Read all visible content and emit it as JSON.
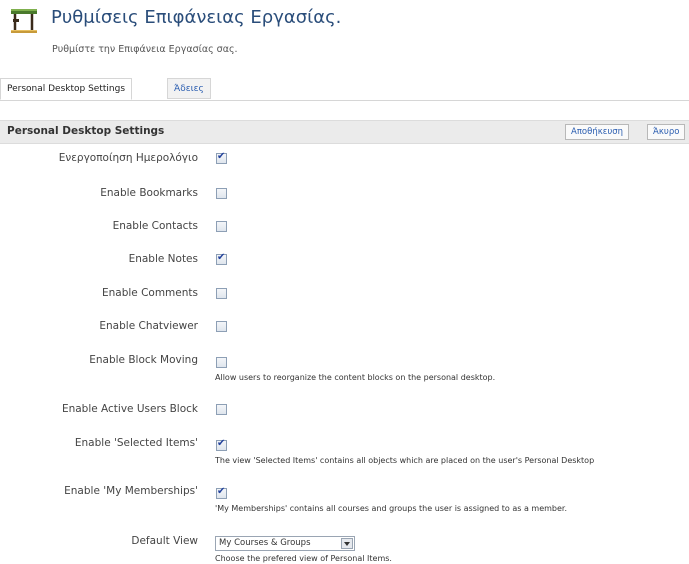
{
  "header": {
    "title": "Ρυθμίσεις Επιφάνειας Εργασίας.",
    "subtitle": "Ρυθμίστε την Επιφάνεια Εργασίας σας.",
    "icon": "desk-icon"
  },
  "tabs": [
    {
      "label": "Personal Desktop Settings",
      "active": true
    },
    {
      "label": "Άδειες",
      "active": false
    }
  ],
  "section": {
    "title": "Personal Desktop Settings",
    "save_label": "Αποθήκευση",
    "cancel_label": "Άκυρο"
  },
  "settings": [
    {
      "label": "Ενεργοποίηση Ημερολόγιο",
      "checked": true,
      "description": ""
    },
    {
      "label": "Enable Bookmarks",
      "checked": false,
      "description": ""
    },
    {
      "label": "Enable Contacts",
      "checked": false,
      "description": ""
    },
    {
      "label": "Enable Notes",
      "checked": true,
      "description": ""
    },
    {
      "label": "Enable Comments",
      "checked": false,
      "description": ""
    },
    {
      "label": "Enable Chatviewer",
      "checked": false,
      "description": ""
    },
    {
      "label": "Enable Block Moving",
      "checked": false,
      "description": "Allow users to reorganize the content blocks on the personal desktop."
    },
    {
      "label": "Enable Active Users Block",
      "checked": false,
      "description": ""
    },
    {
      "label": "Enable 'Selected Items'",
      "checked": true,
      "description": "The view 'Selected Items' contains all objects which are placed on the user's Personal Desktop"
    },
    {
      "label": "Enable 'My Memberships'",
      "checked": true,
      "description": "'My Memberships' contains all courses and groups the user is assigned to as a member."
    }
  ],
  "default_view": {
    "label": "Default View",
    "selected": "My Courses & Groups",
    "description": "Choose the prefered view of Personal Items."
  }
}
